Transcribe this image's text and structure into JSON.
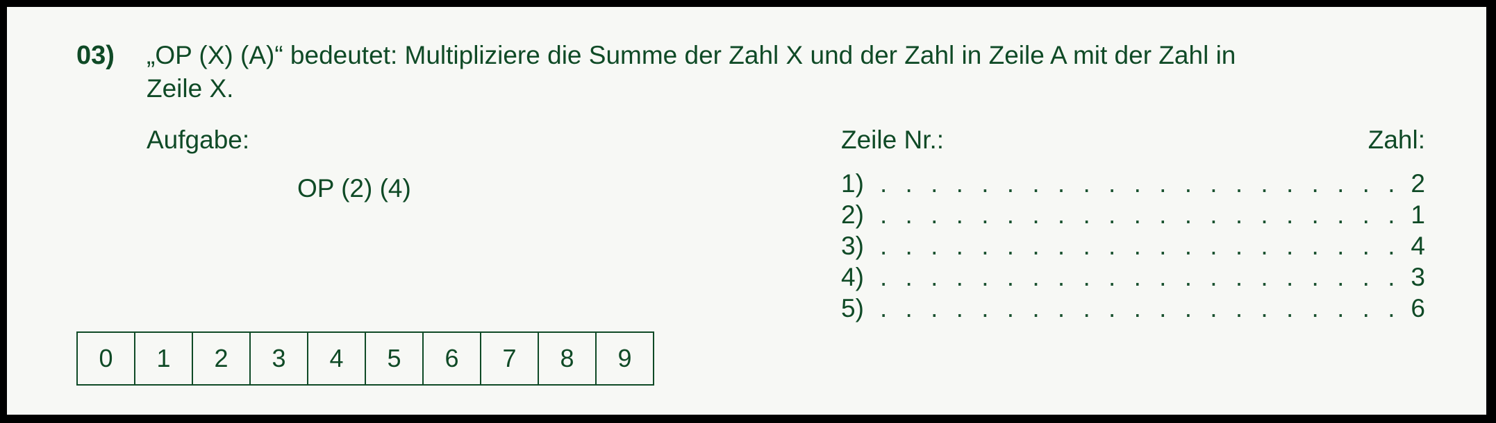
{
  "question": {
    "number": "03)",
    "text": "„OP (X) (A)“ bedeutet: Multipliziere die Summe der Zahl X und der Zahl in Zeile A mit der Zahl in\nZeile X."
  },
  "task": {
    "label": "Aufgabe:",
    "expression": "OP (2) (4)"
  },
  "table": {
    "header_row": "Zeile Nr.:",
    "header_value": "Zahl:",
    "rows": [
      {
        "label": "1)",
        "value": "2"
      },
      {
        "label": "2)",
        "value": "1"
      },
      {
        "label": "3)",
        "value": "4"
      },
      {
        "label": "4)",
        "value": "3"
      },
      {
        "label": "5)",
        "value": "6"
      }
    ]
  },
  "answer_digits": [
    "0",
    "1",
    "2",
    "3",
    "4",
    "5",
    "6",
    "7",
    "8",
    "9"
  ]
}
